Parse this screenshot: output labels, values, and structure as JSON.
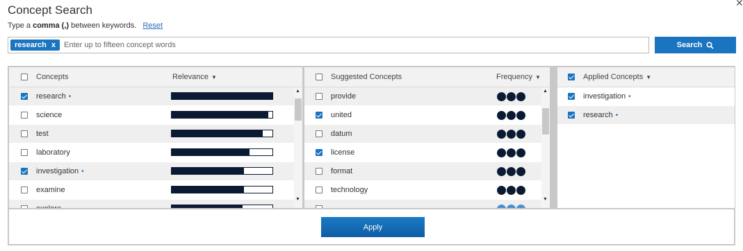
{
  "dialog": {
    "title": "Concept Search",
    "hint_prefix": "Type a",
    "hint_bold": "comma (,)",
    "hint_suffix": "between keywords.",
    "reset_label": "Reset",
    "close_icon": "close-icon"
  },
  "search": {
    "chip_label": "research",
    "chip_remove": "x",
    "placeholder": "Enter up to fifteen concept words",
    "value": "",
    "button_label": "Search",
    "button_icon": "search-icon"
  },
  "concepts_panel": {
    "header_label": "Concepts",
    "relevance_label": "Relevance",
    "rows": [
      {
        "label": "research",
        "checked": true,
        "dot": "•",
        "relevance": 1.0
      },
      {
        "label": "science",
        "checked": false,
        "dot": "",
        "relevance": 0.96
      },
      {
        "label": "test",
        "checked": false,
        "dot": "",
        "relevance": 0.9
      },
      {
        "label": "laboratory",
        "checked": false,
        "dot": "",
        "relevance": 0.77
      },
      {
        "label": "investigation",
        "checked": true,
        "dot": "•",
        "relevance": 0.72
      },
      {
        "label": "examine",
        "checked": false,
        "dot": "",
        "relevance": 0.72
      },
      {
        "label": "explore",
        "checked": false,
        "dot": "",
        "relevance": 0.7
      }
    ]
  },
  "suggested_panel": {
    "header_label": "Suggested Concepts",
    "frequency_label": "Frequency",
    "rows": [
      {
        "label": "provide",
        "checked": false,
        "frequency": 3
      },
      {
        "label": "united",
        "checked": true,
        "frequency": 3
      },
      {
        "label": "datum",
        "checked": false,
        "frequency": 3
      },
      {
        "label": "license",
        "checked": true,
        "frequency": 3
      },
      {
        "label": "format",
        "checked": false,
        "frequency": 3
      },
      {
        "label": "technology",
        "checked": false,
        "frequency": 3
      },
      {
        "label": "",
        "checked": false,
        "frequency": 2
      }
    ]
  },
  "applied_panel": {
    "header_label": "Applied Concepts",
    "rows": [
      {
        "label": "investigation",
        "checked": true,
        "dot": "•"
      },
      {
        "label": "research",
        "checked": true,
        "dot": "•"
      }
    ]
  },
  "footer": {
    "apply_label": "Apply"
  },
  "colors": {
    "accent": "#1a74c0",
    "bar_fill": "#0b1a33",
    "row_alt": "#efefef",
    "header_bg": "#f2f2f2"
  }
}
